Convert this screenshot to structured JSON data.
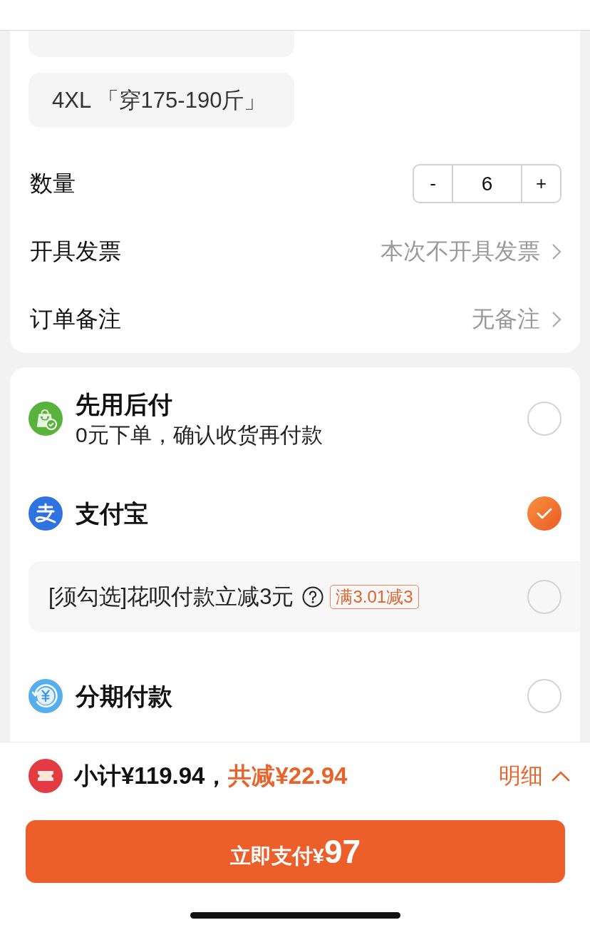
{
  "size_options": [
    {
      "selected": false
    },
    {
      "label": "4XL 「穿175-190斤」",
      "selected": false
    }
  ],
  "quantity": {
    "label": "数量",
    "decrement": "-",
    "value": "6",
    "increment": "+"
  },
  "settings": [
    {
      "label": "开具发票",
      "value": "本次不开具发票"
    },
    {
      "label": "订单备注",
      "value": "无备注"
    }
  ],
  "payment_methods": [
    {
      "kind": "pay_later",
      "title": "先用后付",
      "subtitle": "0元下单，确认收货再付款",
      "selected": false
    },
    {
      "kind": "alipay",
      "title": "支付宝",
      "selected": true
    },
    {
      "kind": "promo",
      "text": "[须勾选]花呗付款立减3元",
      "tag": "满3.01减3",
      "checked": false
    },
    {
      "kind": "installment",
      "title": "分期付款",
      "selected": false
    }
  ],
  "summary": {
    "subtotal": "小计¥119.94，",
    "discount": "共减¥22.94",
    "details": "明细"
  },
  "pay_button": {
    "label": "立即支付¥",
    "amount": "97"
  }
}
